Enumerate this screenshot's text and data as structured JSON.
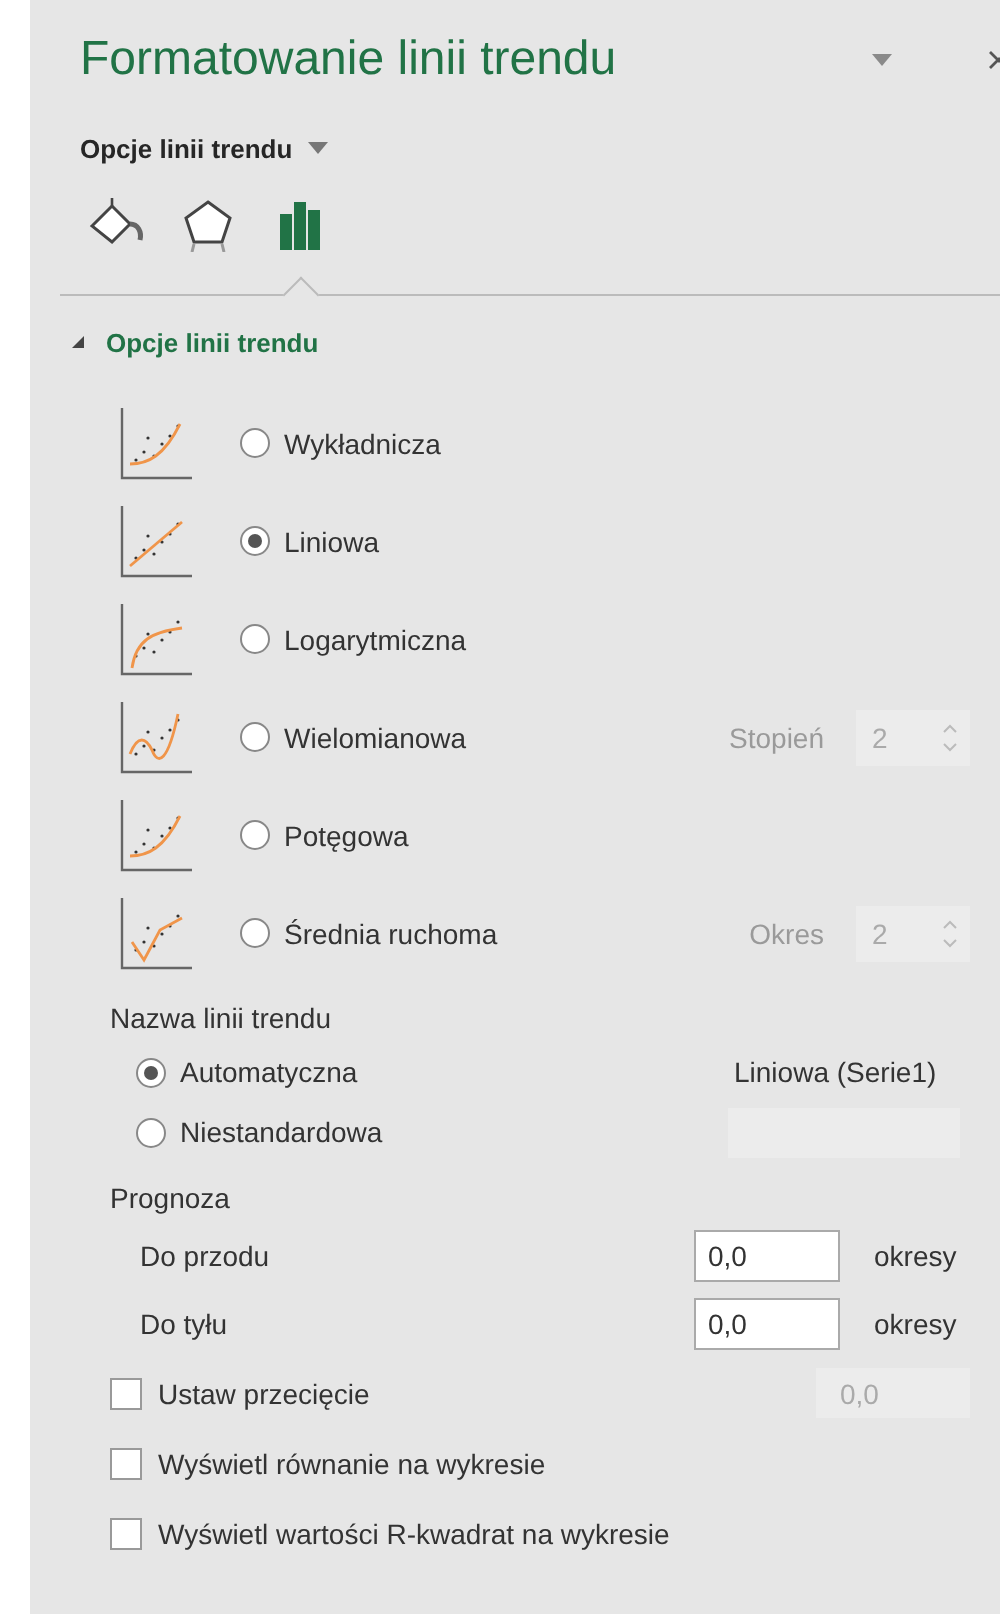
{
  "title": "Formatowanie linii trendu",
  "subtitle": "Opcje linii trendu",
  "tabs": [
    {
      "kind": "fill",
      "selected": false
    },
    {
      "kind": "effects",
      "selected": false
    },
    {
      "kind": "options",
      "selected": true
    }
  ],
  "section": {
    "title": "Opcje linii trendu",
    "expanded": true
  },
  "trend_types": [
    {
      "kind": "exponential",
      "label": "Wykładnicza",
      "selected": false
    },
    {
      "kind": "linear",
      "label": "Liniowa",
      "selected": true
    },
    {
      "kind": "logarithmic",
      "label": "Logarytmiczna",
      "selected": false
    },
    {
      "kind": "polynomial",
      "label": "Wielomianowa",
      "selected": false,
      "option": {
        "label": "Stopień",
        "value": "2",
        "disabled": true
      }
    },
    {
      "kind": "power",
      "label": "Potęgowa",
      "selected": false
    },
    {
      "kind": "moving",
      "label": "Średnia ruchoma",
      "selected": false,
      "option": {
        "label": "Okres",
        "value": "2",
        "disabled": true
      }
    }
  ],
  "trend_name": {
    "label": "Nazwa linii trendu",
    "options": [
      {
        "label": "Automatyczna",
        "selected": true,
        "kind": "auto",
        "value": "Liniowa (Serie1)"
      },
      {
        "label": "Niestandardowa",
        "selected": false,
        "kind": "custom"
      }
    ]
  },
  "forecast": {
    "label": "Prognoza",
    "rows": [
      {
        "label": "Do przodu",
        "value": "0,0",
        "unit": "okresy"
      },
      {
        "label": "Do tyłu",
        "value": "0,0",
        "unit": "okresy"
      }
    ]
  },
  "intercept": {
    "label": "Ustaw przecięcie",
    "checked": false,
    "value": "0,0",
    "disabled": true
  },
  "checkboxes": [
    {
      "label": "Wyświetl równanie na wykresie",
      "checked": false
    },
    {
      "label": "Wyświetl wartości R-kwadrat na wykresie",
      "checked": false
    }
  ]
}
